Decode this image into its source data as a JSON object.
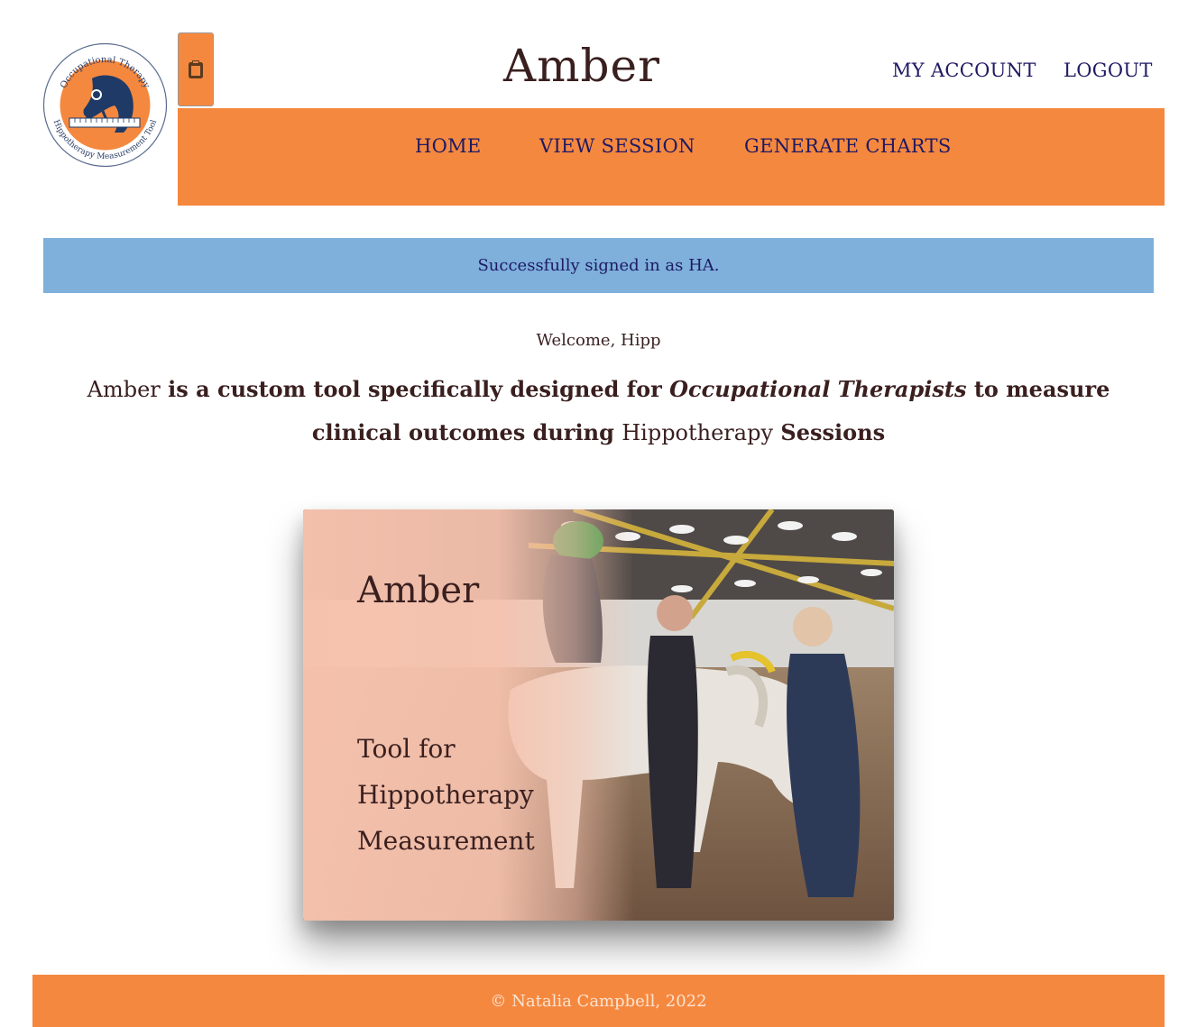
{
  "header": {
    "site_title": "Amber",
    "account_links": {
      "my_account": "MY ACCOUNT",
      "logout": "LOGOUT"
    }
  },
  "logo": {
    "top_text": "Occupational Therapy",
    "bottom_text": "Hippotherapy Measurement Tool"
  },
  "navbar": {
    "items": [
      {
        "label": "HOME"
      },
      {
        "label": "VIEW SESSION"
      },
      {
        "label": "GENERATE CHARTS"
      }
    ]
  },
  "alert": {
    "message": "Successfully signed in as HA."
  },
  "main": {
    "welcome": "Welcome, Hipp",
    "intro": {
      "part1": "Amber",
      "part2": " is a custom tool specifically designed for ",
      "part3": "Occupational Therapists",
      "part4": " to measure clinical outcomes during ",
      "part5": "Hippotherapy",
      "part6": " Sessions"
    }
  },
  "hero": {
    "title": "Amber",
    "subtitle": "Tool for Hippotherapy Measurement"
  },
  "footer": {
    "copyright": "© Natalia Campbell, 2022"
  },
  "colors": {
    "accent_orange": "#f5883f",
    "nav_text": "#1f1a63",
    "alert_bg": "#7eb0db",
    "text_dark": "#3a1f1f"
  },
  "icons": {
    "menu_toggle": "clipboard-icon"
  }
}
